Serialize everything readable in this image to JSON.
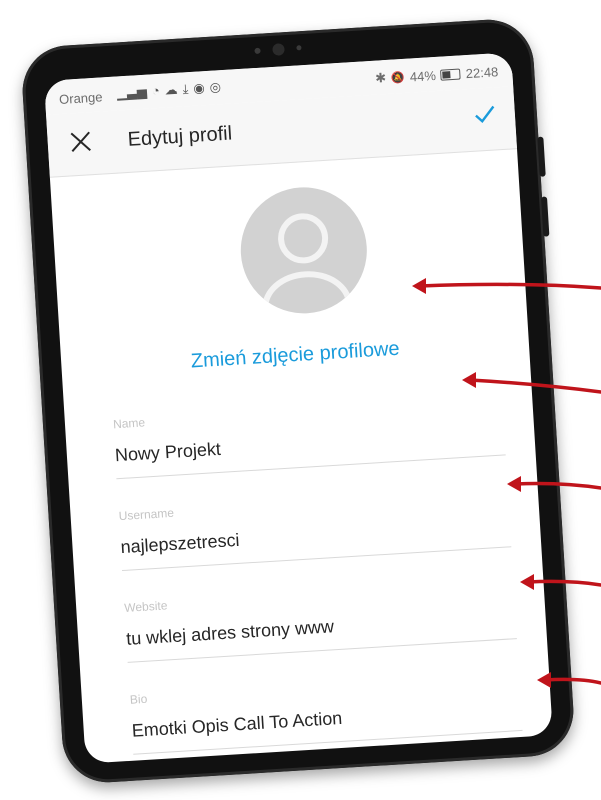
{
  "status_bar": {
    "carrier": "Orange",
    "left_icons": [
      "signal-icon",
      "wifi-icon",
      "cloud-icon",
      "download-icon",
      "incognito-icon",
      "instagram-icon"
    ],
    "bluetooth": "✱",
    "mute": "🔕",
    "battery_level": "44%",
    "time": "22:48"
  },
  "header": {
    "title": "Edytuj profil"
  },
  "profile": {
    "change_photo_label": "Zmień zdjęcie profilowe"
  },
  "fields": [
    {
      "label": "Name",
      "value": "Nowy Projekt"
    },
    {
      "label": "Username",
      "value": "najlepszetresci"
    },
    {
      "label": "Website",
      "value": "tu wklej adres strony www"
    },
    {
      "label": "Bio",
      "value": "Emotki Opis Call To Action"
    }
  ],
  "colors": {
    "accent": "#1a9bdb",
    "arrow": "#c0141b",
    "device": "#111111"
  }
}
